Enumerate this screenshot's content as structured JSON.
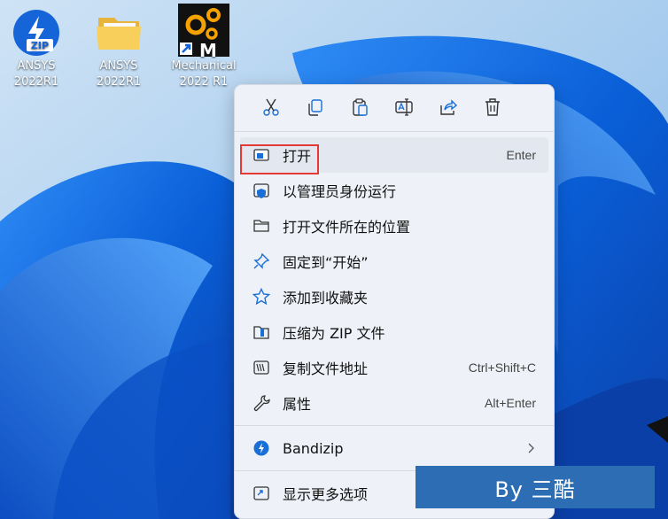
{
  "desktop": {
    "icons": [
      {
        "label": "ANSYS\n2022R1",
        "icon": "ansys-zip-icon"
      },
      {
        "label": "ANSYS\n2022R1",
        "icon": "folder-icon"
      },
      {
        "label": "Mechanical\n2022 R1",
        "icon": "mechanical-app-icon"
      }
    ]
  },
  "context_menu": {
    "toolbar": [
      {
        "name": "cut-icon"
      },
      {
        "name": "copy-icon"
      },
      {
        "name": "paste-icon"
      },
      {
        "name": "rename-icon"
      },
      {
        "name": "share-icon"
      },
      {
        "name": "delete-icon"
      }
    ],
    "items": [
      {
        "label": "打开",
        "shortcut": "Enter",
        "icon": "open-window-icon"
      },
      {
        "label": "以管理员身份运行",
        "shortcut": "",
        "icon": "shield-icon"
      },
      {
        "label": "打开文件所在的位置",
        "shortcut": "",
        "icon": "folder-icon"
      },
      {
        "label": "固定到“开始”",
        "shortcut": "",
        "icon": "pin-icon"
      },
      {
        "label": "添加到收藏夹",
        "shortcut": "",
        "icon": "star-icon"
      },
      {
        "label": "压缩为 ZIP 文件",
        "shortcut": "",
        "icon": "zip-icon"
      },
      {
        "label": "复制文件地址",
        "shortcut": "Ctrl+Shift+C",
        "icon": "copy-path-icon"
      },
      {
        "label": "属性",
        "shortcut": "Alt+Enter",
        "icon": "wrench-icon"
      },
      {
        "label": "Bandizip",
        "shortcut": "",
        "icon": "bandizip-icon"
      },
      {
        "label": "显示更多选项",
        "shortcut": "",
        "icon": "more-options-icon"
      }
    ]
  },
  "watermark": "By 三酷",
  "colors": {
    "accent": "#1a6fd6",
    "highlight_box": "#e53935",
    "watermark_bg": "#2c6db3"
  }
}
